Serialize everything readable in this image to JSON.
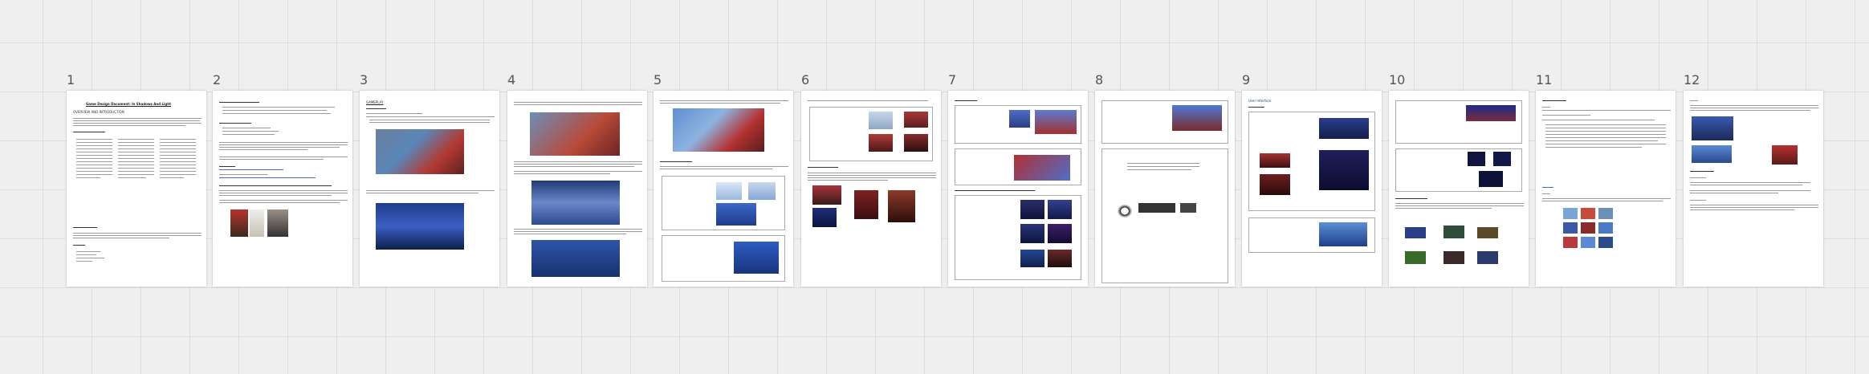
{
  "pages": [
    {
      "number": "1",
      "title": "Game Design Document: In Shadows And Light",
      "subtitle": "OVERVIEW AND INTRODUCTION"
    },
    {
      "number": "2"
    },
    {
      "number": "3",
      "title": "GAMEPLAY"
    },
    {
      "number": "4"
    },
    {
      "number": "5"
    },
    {
      "number": "6"
    },
    {
      "number": "7"
    },
    {
      "number": "8"
    },
    {
      "number": "9",
      "title": "User Interface"
    },
    {
      "number": "10"
    },
    {
      "number": "11"
    },
    {
      "number": "12"
    }
  ]
}
